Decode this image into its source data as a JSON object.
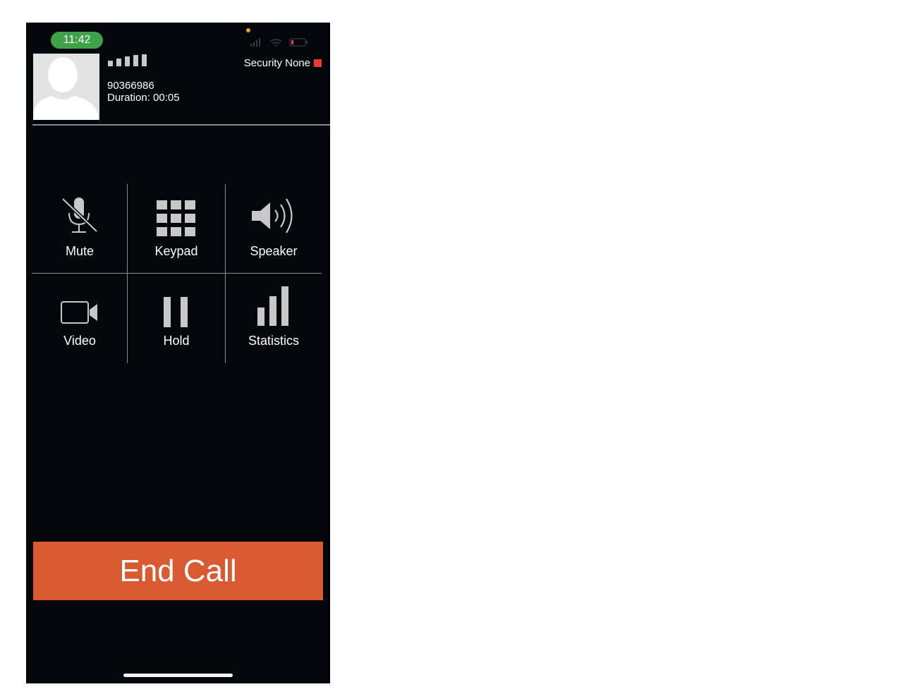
{
  "status_bar": {
    "time": "11:42"
  },
  "header": {
    "security_label": "Security None",
    "caller_number": "90366986",
    "duration": "Duration: 00:05"
  },
  "controls": [
    {
      "label": "Mute",
      "icon": "muted-microphone-icon"
    },
    {
      "label": "Keypad",
      "icon": "keypad-icon"
    },
    {
      "label": "Speaker",
      "icon": "speaker-icon"
    },
    {
      "label": "Video",
      "icon": "video-camera-icon"
    },
    {
      "label": "Hold",
      "icon": "pause-icon"
    },
    {
      "label": "Statistics",
      "icon": "bar-chart-icon"
    }
  ],
  "end_call": {
    "label": "End Call"
  },
  "colors": {
    "background": "#05050c",
    "time_pill": "#3fa14a",
    "security_indicator": "#e63a2e",
    "end_call": "#d95a31",
    "icon_gray": "#c8c8c8"
  }
}
